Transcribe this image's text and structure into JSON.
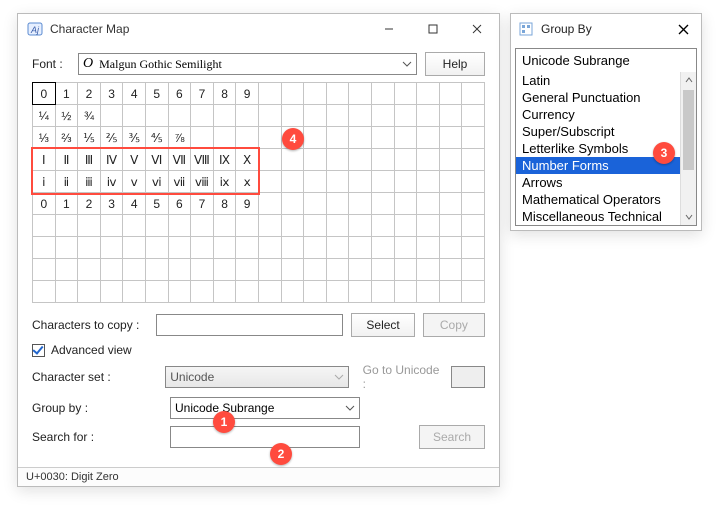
{
  "main": {
    "title": "Character Map",
    "font_label": "Font :",
    "font_value": "Malgun Gothic Semilight",
    "help_label": "Help",
    "grid_cols": 20,
    "grid_rows": 10,
    "grid_selected": [
      0,
      0
    ],
    "grid_highlight_rows": [
      3,
      4
    ],
    "grid": [
      [
        "0",
        "1",
        "2",
        "3",
        "4",
        "5",
        "6",
        "7",
        "8",
        "9",
        "",
        "",
        "",
        "",
        "",
        "",
        "",
        "",
        "",
        ""
      ],
      [
        "¼",
        "½",
        "¾",
        "",
        "",
        "",
        "",
        "",
        "",
        "",
        "",
        "",
        "",
        "",
        "",
        "",
        "",
        "",
        "",
        ""
      ],
      [
        "⅓",
        "⅔",
        "⅕",
        "⅖",
        "⅗",
        "⅘",
        "⅞",
        "",
        "",
        "",
        "",
        "",
        "",
        "",
        "",
        "",
        "",
        "",
        "",
        ""
      ],
      [
        "Ⅰ",
        "Ⅱ",
        "Ⅲ",
        "Ⅳ",
        "Ⅴ",
        "Ⅵ",
        "Ⅶ",
        "Ⅷ",
        "Ⅸ",
        "Ⅹ",
        "",
        "",
        "",
        "",
        "",
        "",
        "",
        "",
        "",
        ""
      ],
      [
        "ⅰ",
        "ⅱ",
        "ⅲ",
        "ⅳ",
        "ⅴ",
        "ⅵ",
        "ⅶ",
        "ⅷ",
        "ⅸ",
        "ⅹ",
        "",
        "",
        "",
        "",
        "",
        "",
        "",
        "",
        "",
        ""
      ],
      [
        "0",
        "1",
        "2",
        "3",
        "4",
        "5",
        "6",
        "7",
        "8",
        "9",
        "",
        "",
        "",
        "",
        "",
        "",
        "",
        "",
        "",
        ""
      ],
      [
        "",
        "",
        "",
        "",
        "",
        "",
        "",
        "",
        "",
        "",
        "",
        "",
        "",
        "",
        "",
        "",
        "",
        "",
        "",
        ""
      ],
      [
        "",
        "",
        "",
        "",
        "",
        "",
        "",
        "",
        "",
        "",
        "",
        "",
        "",
        "",
        "",
        "",
        "",
        "",
        "",
        ""
      ],
      [
        "",
        "",
        "",
        "",
        "",
        "",
        "",
        "",
        "",
        "",
        "",
        "",
        "",
        "",
        "",
        "",
        "",
        "",
        "",
        ""
      ],
      [
        "",
        "",
        "",
        "",
        "",
        "",
        "",
        "",
        "",
        "",
        "",
        "",
        "",
        "",
        "",
        "",
        "",
        "",
        "",
        ""
      ]
    ],
    "copy_label": "Characters to copy :",
    "copy_value": "",
    "select_btn": "Select",
    "copy_btn": "Copy",
    "advanced_label": "Advanced view",
    "advanced_checked": true,
    "charset_label": "Character set :",
    "charset_value": "Unicode",
    "goto_label": "Go to Unicode :",
    "groupby_label": "Group by :",
    "groupby_value": "Unicode Subrange",
    "search_label": "Search for :",
    "search_value": "",
    "search_btn": "Search",
    "status": "U+0030: Digit Zero"
  },
  "groupby_window": {
    "title": "Group By",
    "header": "Unicode Subrange",
    "items": [
      "Latin",
      "General Punctuation",
      "Currency",
      "Super/Subscript",
      "Letterlike Symbols",
      "Number Forms",
      "Arrows",
      "Mathematical Operators",
      "Miscellaneous Technical"
    ],
    "selected_index": 5
  },
  "badges": {
    "b1": "1",
    "b2": "2",
    "b3": "3",
    "b4": "4"
  }
}
